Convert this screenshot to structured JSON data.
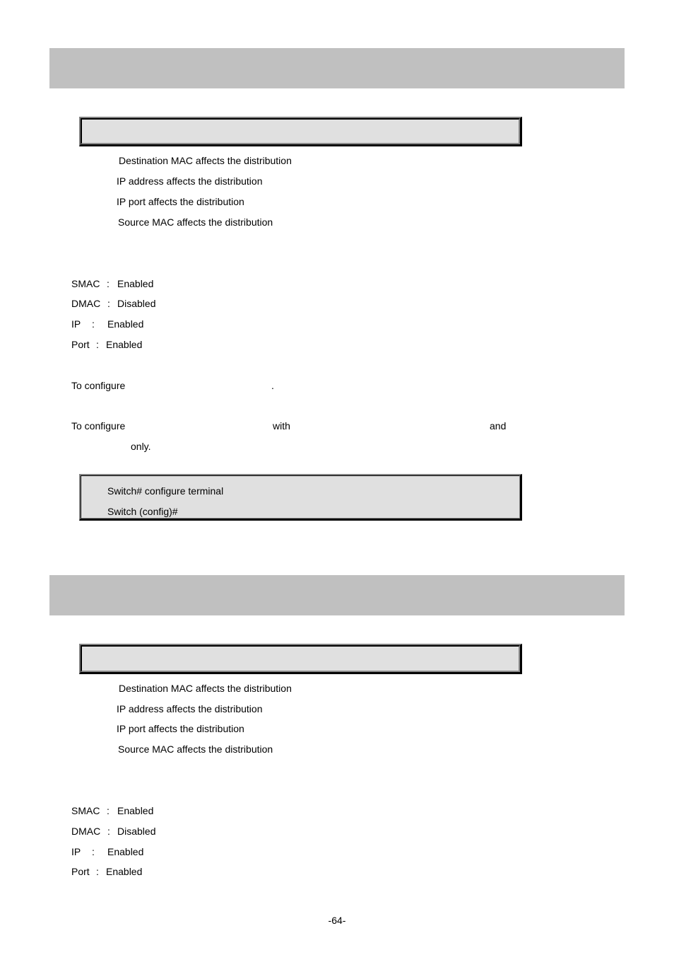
{
  "sections": [
    {
      "header_title": "",
      "syntax": "",
      "parameters": [
        "Destination MAC affects the distribution",
        "IP address affects the distribution",
        "IP port affects the distribution",
        "Source MAC affects the distribution"
      ],
      "defaults": [
        {
          "key": "SMAC",
          "sep": ":",
          "value": "Enabled"
        },
        {
          "key": "DMAC",
          "sep": ":",
          "value": "Disabled"
        },
        {
          "key": "IP",
          "sep": ":",
          "value": "Enabled"
        },
        {
          "key": "Port",
          "sep": ":",
          "value": "Enabled"
        }
      ],
      "usage": {
        "line1_prefix": "To configure",
        "line1_suffix": ".",
        "line2_prefix": "To configure",
        "line2_with": "with",
        "line2_and": "and",
        "line3_only": "only."
      },
      "example": [
        "Switch# configure terminal",
        "Switch (config)#"
      ]
    },
    {
      "header_title": "",
      "syntax": "",
      "parameters": [
        "Destination MAC affects the distribution",
        "IP address affects the distribution",
        "IP port affects the distribution",
        "Source MAC affects the distribution"
      ],
      "defaults": [
        {
          "key": "SMAC",
          "sep": ":",
          "value": "Enabled"
        },
        {
          "key": "DMAC",
          "sep": ":",
          "value": "Disabled"
        },
        {
          "key": "IP",
          "sep": ":",
          "value": "Enabled"
        },
        {
          "key": "Port",
          "sep": ":",
          "value": "Enabled"
        }
      ]
    }
  ],
  "footer": {
    "page_number": "-64-"
  }
}
